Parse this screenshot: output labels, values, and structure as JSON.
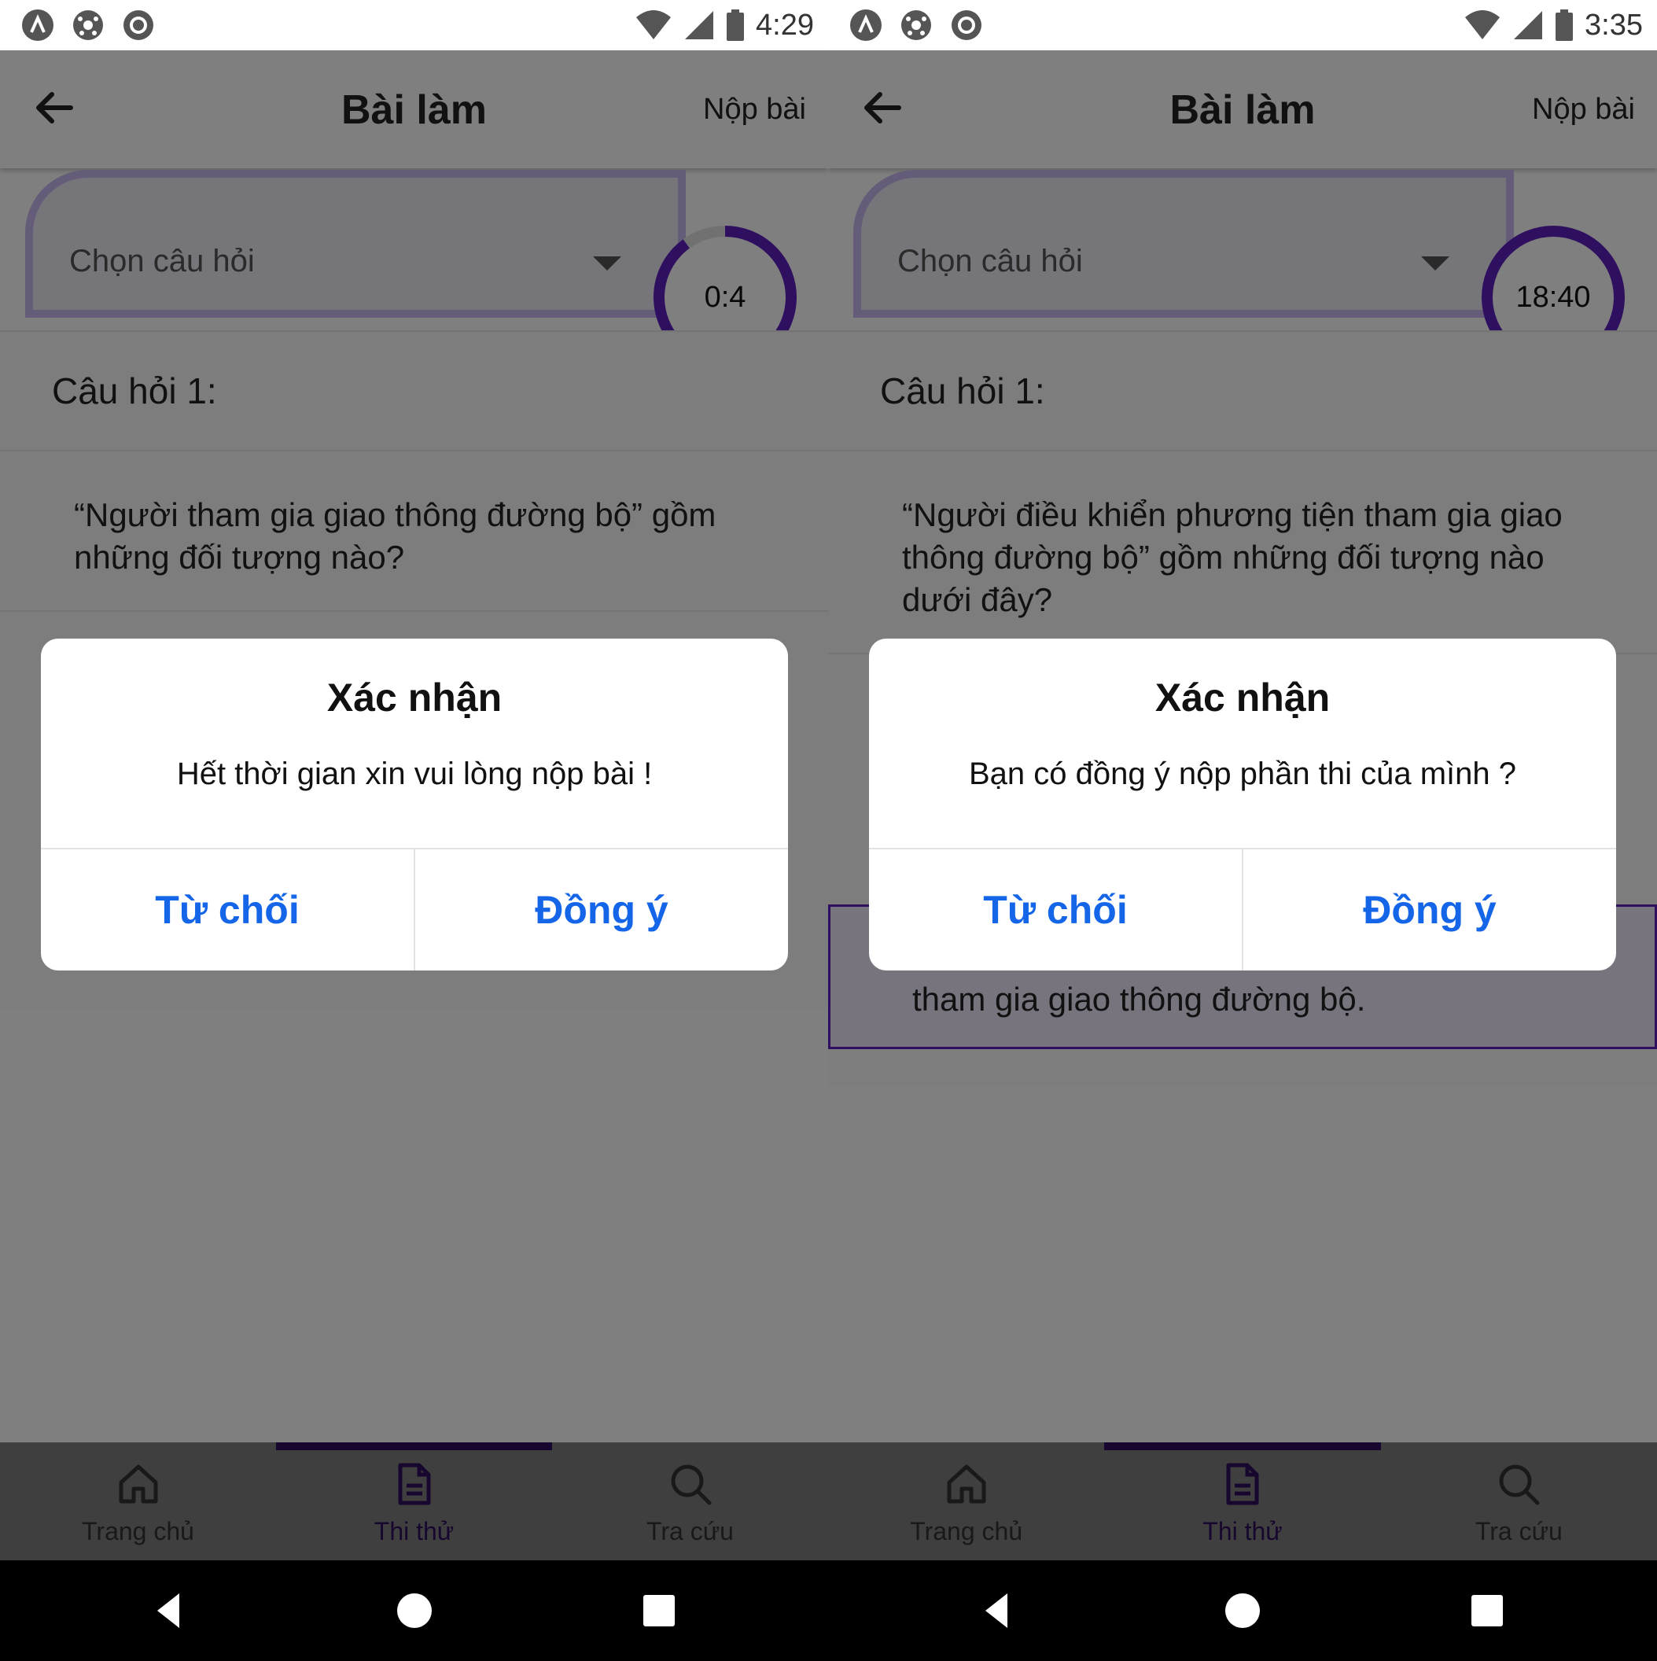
{
  "screens": [
    {
      "status": {
        "time": "4:29"
      },
      "header": {
        "title": "Bài làm",
        "submit_label": "Nộp bài"
      },
      "selector": {
        "placeholder": "Chọn câu hỏi"
      },
      "timer": {
        "value": "0:4",
        "progress_fraction": 0.9
      },
      "question": {
        "number_label": "Câu hỏi 1:",
        "text": "“Người tham gia giao thông đường bộ” gồm những đối tượng nào?",
        "selected_answer_text": ""
      },
      "dialog": {
        "title": "Xác nhận",
        "message": "Hết thời gian xin vui lòng nộp bài !",
        "cancel_label": "Từ chối",
        "confirm_label": "Đồng ý"
      },
      "tabs": [
        {
          "label": "Trang chủ",
          "icon": "home-icon",
          "active": false
        },
        {
          "label": "Thi thử",
          "icon": "document-icon",
          "active": true
        },
        {
          "label": "Tra cứu",
          "icon": "search-icon",
          "active": false
        }
      ]
    },
    {
      "status": {
        "time": "3:35"
      },
      "header": {
        "title": "Bài làm",
        "submit_label": "Nộp bài"
      },
      "selector": {
        "placeholder": "Chọn câu hỏi"
      },
      "timer": {
        "value": "18:40",
        "progress_fraction": 1.0
      },
      "question": {
        "number_label": "Câu hỏi 1:",
        "text": "“Người điều khiển phương tiện tham gia giao thông đường bộ” gồm những đối tượng nào dưới đây?",
        "selected_answer_text": "tham gia giao thông đường bộ."
      },
      "dialog": {
        "title": "Xác nhận",
        "message": "Bạn có đồng ý nộp phần thi của mình ?",
        "cancel_label": "Từ chối",
        "confirm_label": "Đồng ý"
      },
      "tabs": [
        {
          "label": "Trang chủ",
          "icon": "home-icon",
          "active": false
        },
        {
          "label": "Thi thử",
          "icon": "document-icon",
          "active": true
        },
        {
          "label": "Tra cứu",
          "icon": "search-icon",
          "active": false
        }
      ]
    }
  ],
  "colors": {
    "accent": "#5f1fbf",
    "accent_light": "#c9b8f2",
    "dialog_button": "#1565e8",
    "overlay": "rgba(0,0,0,0.5)"
  }
}
